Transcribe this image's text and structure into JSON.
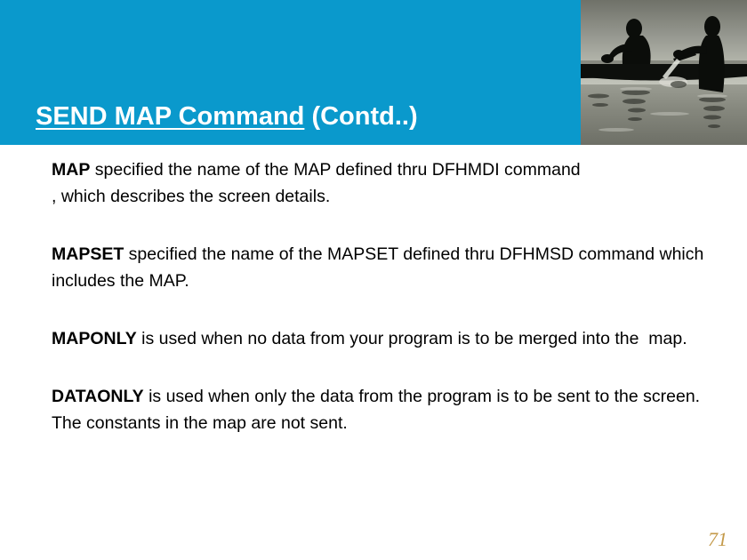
{
  "slide": {
    "title": {
      "underlined_part": "SEND MAP Command",
      "plain_part": " (Contd..)",
      "full": "SEND MAP Command (Contd..)"
    },
    "header": {
      "band_color": "#0a99cc",
      "photo_alt": "silhouette of two men rowing a boat on water"
    },
    "paragraphs": [
      {
        "keyword": "MAP",
        "text": " specified the name of the MAP defined thru DFHMDI command\n, which describes the screen details."
      },
      {
        "keyword": "MAPSET",
        "text": " specified the name of the MAPSET defined thru DFHMSD command which includes the MAP."
      },
      {
        "keyword": "MAPONLY",
        "text": " is used when no data from your program is to be merged into the  map."
      },
      {
        "keyword": "DATAONLY",
        "text": " is used when only the data from the program is to be sent to the screen. The constants in the map are not sent."
      }
    ],
    "page_number": "71",
    "page_number_color": "#c49a4a"
  }
}
